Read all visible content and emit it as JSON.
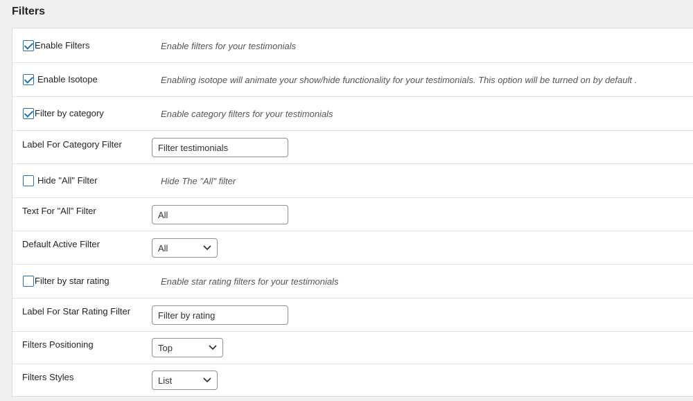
{
  "page": {
    "title": "Filters"
  },
  "settings": {
    "enable_filters": {
      "label": "Enable Filters",
      "checked": true,
      "description": "Enable filters for your testimonials"
    },
    "enable_isotope": {
      "label": "Enable Isotope",
      "checked": true,
      "description": "Enabling isotope will animate your show/hide functionality for your testimonials. This option will be turned on by default ."
    },
    "filter_by_category": {
      "label": "Filter by category",
      "checked": true,
      "description": "Enable category filters for your testimonials"
    },
    "category_filter_label": {
      "label": "Label For Category Filter",
      "value": "Filter testimonials"
    },
    "hide_all_filter": {
      "label": "Hide \"All\" Filter",
      "checked": false,
      "description": "Hide The \"All\" filter"
    },
    "all_filter_text": {
      "label": "Text For \"All\" Filter",
      "value": "All"
    },
    "default_active_filter": {
      "label": "Default Active Filter",
      "selected": "All"
    },
    "filter_by_star_rating": {
      "label": "Filter by star rating",
      "checked": false,
      "description": "Enable star rating filters for your testimonials"
    },
    "star_rating_filter_label": {
      "label": "Label For Star Rating Filter",
      "value": "Filter by rating"
    },
    "filters_positioning": {
      "label": "Filters Positioning",
      "selected": "Top"
    },
    "filters_styles": {
      "label": "Filters Styles",
      "selected": "List"
    }
  },
  "colors": {
    "accent": "#2271b1",
    "background": "#f0f0f1",
    "panel": "#ffffff",
    "border": "#dcdcde"
  }
}
